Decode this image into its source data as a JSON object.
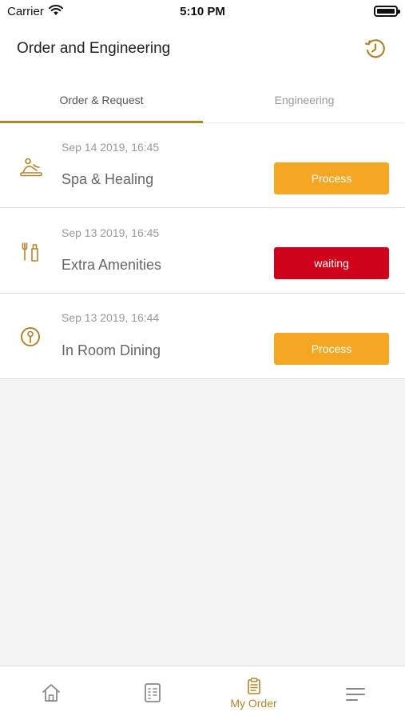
{
  "status_bar": {
    "carrier": "Carrier",
    "time": "5:10 PM"
  },
  "header": {
    "title": "Order and Engineering",
    "history_icon": "history-clock-icon"
  },
  "tabs": [
    {
      "label": "Order & Request",
      "active": true
    },
    {
      "label": "Engineering",
      "active": false
    }
  ],
  "orders": [
    {
      "date": "Sep 14 2019, 16:45",
      "name": "Spa & Healing",
      "status": "Process",
      "icon": "spa-massage-icon"
    },
    {
      "date": "Sep 13 2019, 16:45",
      "name": "Extra Amenities",
      "status": "waiting",
      "icon": "toiletries-icon"
    },
    {
      "date": "Sep 13 2019, 16:44",
      "name": "In Room Dining",
      "status": "Process",
      "icon": "dining-plate-icon"
    }
  ],
  "bottom_tabs": [
    {
      "icon": "home-icon",
      "label": ""
    },
    {
      "icon": "directory-book-icon",
      "label": ""
    },
    {
      "icon": "clipboard-icon",
      "label": "My Order",
      "active": true
    },
    {
      "icon": "menu-icon",
      "label": ""
    }
  ],
  "colors": {
    "accent": "#b0852d",
    "process": "#f5a623",
    "waiting": "#d0021b"
  }
}
